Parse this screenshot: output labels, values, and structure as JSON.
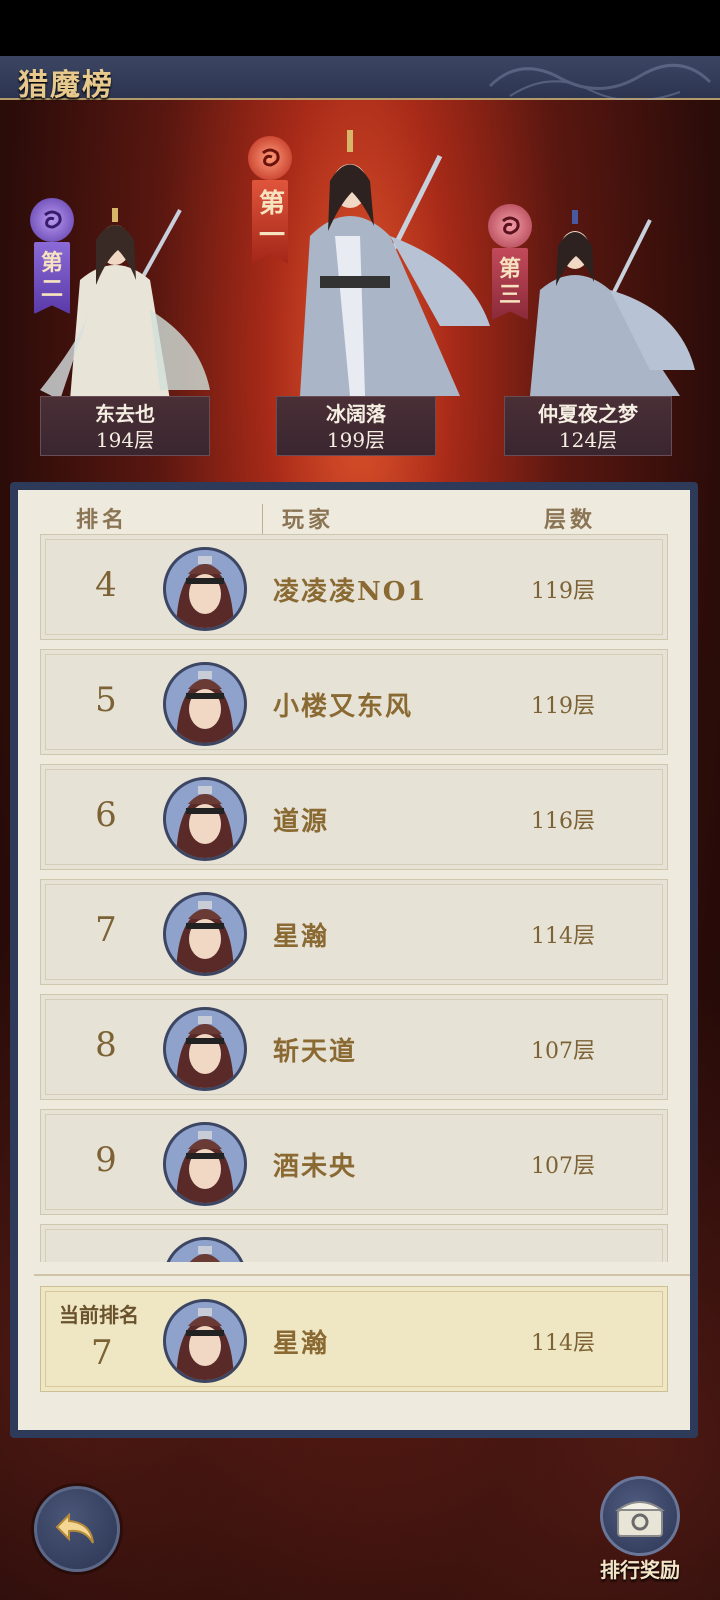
{
  "app": {
    "title": "猎魔榜"
  },
  "podium": [
    {
      "rank_label": "第二",
      "name": "东去也",
      "floors": "194层",
      "orb_color": "#7a5ac8"
    },
    {
      "rank_label": "第一",
      "name": "冰阔落",
      "floors": "199层",
      "orb_color": "#c23a2a"
    },
    {
      "rank_label": "第三",
      "name": "仲夏夜之梦",
      "floors": "124层",
      "orb_color": "#b3414e"
    }
  ],
  "table": {
    "headers": {
      "rank": "排名",
      "player": "玩家",
      "floors": "层数"
    },
    "rows": [
      {
        "rank": "4",
        "name": "凌凌凌NO1",
        "floors": "119层"
      },
      {
        "rank": "5",
        "name": "小楼又东风",
        "floors": "119层"
      },
      {
        "rank": "6",
        "name": "道源",
        "floors": "116层"
      },
      {
        "rank": "7",
        "name": "星瀚",
        "floors": "114层"
      },
      {
        "rank": "8",
        "name": "斩天道",
        "floors": "107层"
      },
      {
        "rank": "9",
        "name": "酒未央",
        "floors": "107层"
      }
    ]
  },
  "current": {
    "label": "当前排名",
    "rank": "7",
    "name": "星瀚",
    "floors": "114层"
  },
  "buttons": {
    "back_icon": "back-arrow-icon",
    "reward_label": "排行奖励",
    "reward_icon": "treasure-chest-icon"
  },
  "colors": {
    "panel_frame": "#2e3a5a",
    "panel_bg": "#efeade",
    "text_gold": "#8a6a32",
    "highlight_row": "#efe6c4"
  }
}
